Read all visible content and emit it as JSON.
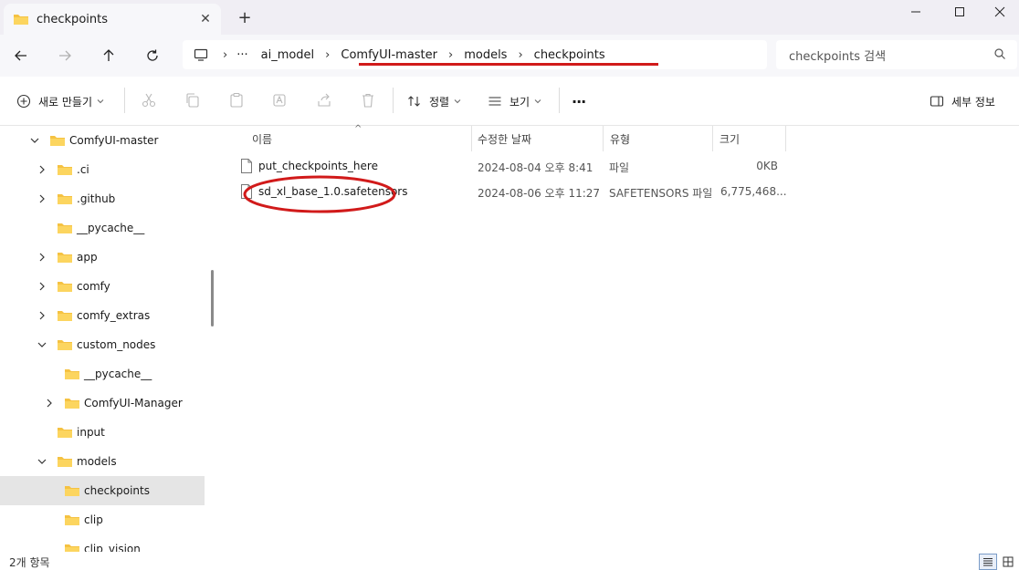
{
  "window": {
    "tab_title": "checkpoints",
    "tab_close": "✕",
    "new_tab": "+",
    "minimize": "—",
    "maximize": "☐",
    "close": "✕"
  },
  "nav": {
    "overflow": "···",
    "breadcrumbs": [
      "ai_model",
      "ComfyUI-master",
      "models",
      "checkpoints"
    ],
    "separator": "›",
    "search_placeholder": "checkpoints 검색"
  },
  "toolbar": {
    "new_label": "새로 만들기",
    "sort_label": "정렬",
    "view_label": "보기",
    "more_label": "···",
    "details_label": "세부 정보"
  },
  "sidebar": {
    "items": [
      {
        "label": "ComfyUI-master",
        "expanded": true
      },
      {
        "label": ".ci"
      },
      {
        "label": ".github"
      },
      {
        "label": "__pycache__"
      },
      {
        "label": "app"
      },
      {
        "label": "comfy"
      },
      {
        "label": "comfy_extras"
      },
      {
        "label": "custom_nodes",
        "expanded": true
      },
      {
        "label": "__pycache__"
      },
      {
        "label": "ComfyUI-Manager"
      },
      {
        "label": "input"
      },
      {
        "label": "models",
        "expanded": true
      },
      {
        "label": "checkpoints",
        "selected": true
      },
      {
        "label": "clip"
      },
      {
        "label": "clip_vision"
      }
    ]
  },
  "file_list": {
    "columns": [
      "이름",
      "수정한 날짜",
      "유형",
      "크기"
    ],
    "rows": [
      {
        "name": "put_checkpoints_here",
        "date": "2024-08-04 오후 8:41",
        "type": "파일",
        "size": "0KB"
      },
      {
        "name": "sd_xl_base_1.0.safetensors",
        "date": "2024-08-06 오후 11:27",
        "type": "SAFETENSORS 파일",
        "size": "6,775,468..."
      }
    ]
  },
  "status": {
    "item_count": "2개 항목"
  },
  "colors": {
    "accent_folder": "#f5c242",
    "annotation_red": "#d11a1a"
  }
}
